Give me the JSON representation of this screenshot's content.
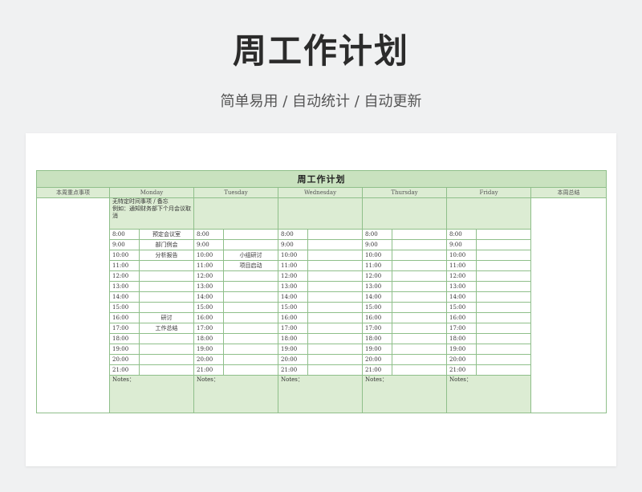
{
  "hero": {
    "title": "周工作计划",
    "subtitle": "简单易用  /  自动统计  /  自动更新"
  },
  "sheet": {
    "title": "周工作计划",
    "left_header": "本周重点事项",
    "right_header": "本周总结",
    "days": [
      "Monday",
      "Tuesday",
      "Wednesday",
      "Thursday",
      "Friday"
    ],
    "note_text": "无特定时间事项 / 备忘\n例如：通知财务部下个月会议取消",
    "times": [
      "8:00",
      "9:00",
      "10:00",
      "11:00",
      "12:00",
      "13:00",
      "14:00",
      "15:00",
      "16:00",
      "17:00",
      "18:00",
      "19:00",
      "20:00",
      "21:00"
    ],
    "tasks": {
      "monday": [
        "预定会议室",
        "部门例会",
        "分析报告",
        "",
        "",
        "",
        "",
        "",
        "研讨",
        "工作总结",
        "",
        "",
        "",
        ""
      ],
      "tuesday": [
        "",
        "",
        "小组研讨",
        "项目启动",
        "",
        "",
        "",
        "",
        "",
        "",
        "",
        "",
        "",
        ""
      ]
    },
    "notes_label": "Notes："
  },
  "colors": {
    "header_green": "#c9e2bf",
    "light_green": "#dcecd3",
    "border_green": "#8fbf8a"
  }
}
